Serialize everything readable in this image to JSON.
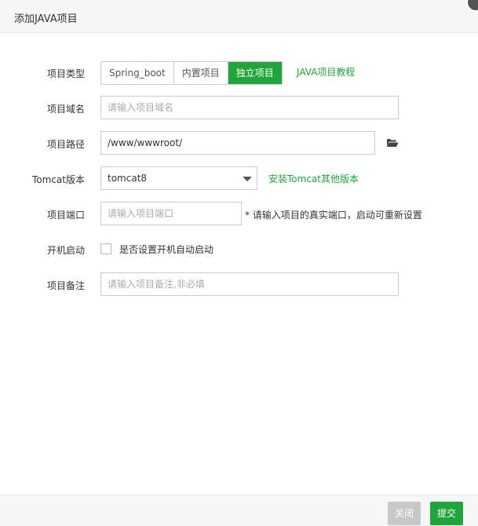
{
  "dialog": {
    "title": "添加JAVA项目"
  },
  "form": {
    "type": {
      "label": "项目类型",
      "options": [
        "Spring_boot",
        "内置项目",
        "独立项目"
      ],
      "selected": "独立项目",
      "tutorial_link": "JAVA项目教程"
    },
    "domain": {
      "label": "项目域名",
      "value": "",
      "placeholder": "请输入项目域名"
    },
    "path": {
      "label": "项目路径",
      "value": "/www/wwwroot/",
      "placeholder": "",
      "icon": "folder-open-icon"
    },
    "tomcat": {
      "label": "Tomcat版本",
      "value": "tomcat8",
      "install_link": "安装Tomcat其他版本"
    },
    "port": {
      "label": "项目端口",
      "value": "",
      "placeholder": "请输入项目端口",
      "hint": "* 请输入项目的真实端口，启动可重新设置"
    },
    "autostart": {
      "label": "开机启动",
      "checkbox_label": "是否设置开机自动启动",
      "checked": false
    },
    "note": {
      "label": "项目备注",
      "value": "",
      "placeholder": "请输入项目备注,非必填"
    }
  },
  "footer": {
    "cancel_label": "关闭",
    "submit_label": "提交"
  },
  "colors": {
    "accent": "#20a53a",
    "disabled": "#c8c8c8"
  }
}
